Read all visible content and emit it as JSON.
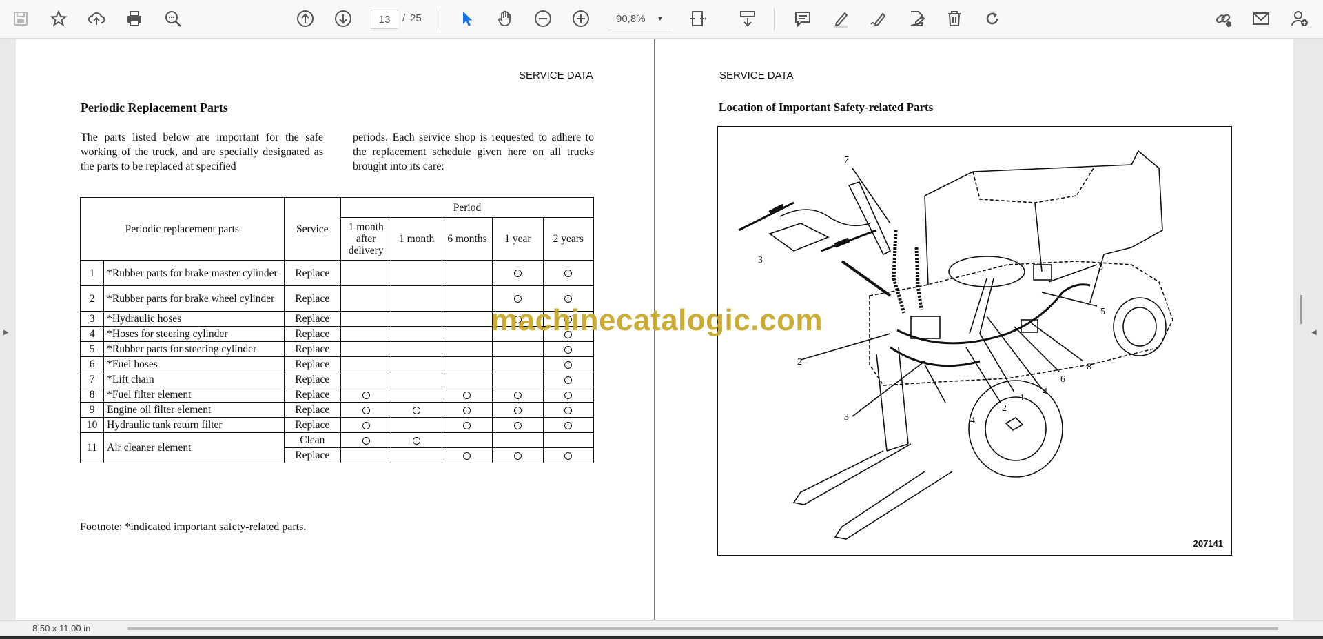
{
  "toolbar": {
    "page_current": "13",
    "page_separator": "/",
    "page_total": "25",
    "zoom": "90,8%"
  },
  "left_page": {
    "header": "SERVICE DATA",
    "title": "Periodic Replacement Parts",
    "intro_col1": "The parts listed below are important for the safe working of the truck, and are specially designated as the parts to be replaced at specified",
    "intro_col2": "periods. Each service shop is requested to adhere to the replacement schedule given here on all trucks brought into its care:",
    "table": {
      "col_parts": "Periodic replacement parts",
      "col_service": "Service",
      "col_period": "Period",
      "periods": [
        "1 month after delivery",
        "1 month",
        "6 months",
        "1 year",
        "2 years"
      ],
      "rows": [
        {
          "no": "1",
          "part": "*Rubber parts for brake master cylinder",
          "service": "Replace",
          "marks": [
            false,
            false,
            false,
            true,
            true
          ]
        },
        {
          "no": "2",
          "part": "*Rubber parts for brake wheel cylinder",
          "service": "Replace",
          "marks": [
            false,
            false,
            false,
            true,
            true
          ]
        },
        {
          "no": "3",
          "part": "*Hydraulic hoses",
          "service": "Replace",
          "marks": [
            false,
            false,
            false,
            true,
            true
          ]
        },
        {
          "no": "4",
          "part": "*Hoses for steering cylinder",
          "service": "Replace",
          "marks": [
            false,
            false,
            false,
            false,
            true
          ]
        },
        {
          "no": "5",
          "part": "*Rubber parts for steering cylinder",
          "service": "Replace",
          "marks": [
            false,
            false,
            false,
            false,
            true
          ]
        },
        {
          "no": "6",
          "part": "*Fuel hoses",
          "service": "Replace",
          "marks": [
            false,
            false,
            false,
            false,
            true
          ]
        },
        {
          "no": "7",
          "part": "*Lift chain",
          "service": "Replace",
          "marks": [
            false,
            false,
            false,
            false,
            true
          ]
        },
        {
          "no": "8",
          "part": "*Fuel filter element",
          "service": "Replace",
          "marks": [
            true,
            false,
            true,
            true,
            true
          ]
        },
        {
          "no": "9",
          "part": "Engine oil filter element",
          "service": "Replace",
          "marks": [
            true,
            true,
            true,
            true,
            true
          ]
        },
        {
          "no": "10",
          "part": "Hydraulic tank return filter",
          "service": "Replace",
          "marks": [
            true,
            false,
            true,
            true,
            true
          ]
        }
      ],
      "row11": {
        "no": "11",
        "part": "Air cleaner element",
        "sub": [
          {
            "service": "Clean",
            "marks": [
              true,
              true,
              false,
              false,
              false
            ]
          },
          {
            "service": "Replace",
            "marks": [
              false,
              false,
              true,
              true,
              true
            ]
          }
        ]
      }
    },
    "footnote": "Footnote: *indicated important safety-related parts."
  },
  "right_page": {
    "header": "SERVICE DATA",
    "title": "Location of Important Safety-related Parts",
    "figure_number": "207141",
    "callouts": [
      "7",
      "3",
      "3",
      "5",
      "2",
      "8",
      "6",
      "4",
      "1",
      "2",
      "3",
      "4"
    ]
  },
  "watermark": "machinecatalogic.com",
  "status": {
    "page_size": "8,50 x 11,00 in"
  }
}
